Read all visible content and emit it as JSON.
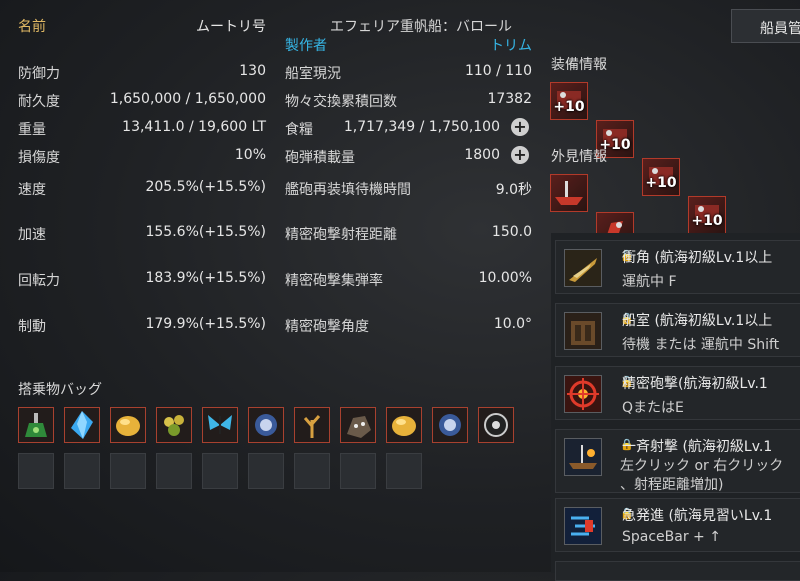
{
  "ship": {
    "name_label": "名前",
    "name_value": "ムートリ号",
    "type_value": "エフェリア重帆船：バロール",
    "maker_label": "製作者",
    "maker_value": "トリム"
  },
  "stats_left": [
    {
      "label": "防御力",
      "value": "130"
    },
    {
      "label": "耐久度",
      "value": "1,650,000 / 1,650,000"
    },
    {
      "label": "重量",
      "value": "13,411.0 / 19,600 LT"
    },
    {
      "label": "損傷度",
      "value": "10%"
    },
    {
      "label": "速度",
      "value": "205.5%(+15.5%)"
    },
    {
      "label": "加速",
      "value": "155.6%(+15.5%)"
    },
    {
      "label": "回転力",
      "value": "183.9%(+15.5%)"
    },
    {
      "label": "制動",
      "value": "179.9%(+15.5%)"
    }
  ],
  "stats_right": [
    {
      "label": "船室現況",
      "value": "110 / 110"
    },
    {
      "label": "物々交換累積回数",
      "value": "17382"
    },
    {
      "label": "食糧",
      "value": "1,717,349 / 1,750,100"
    },
    {
      "label": "砲弾積載量",
      "value": "1800"
    },
    {
      "label": "艦砲再装填待機時間",
      "value": "9.0秒"
    },
    {
      "label": "精密砲撃射程距離",
      "value": "150.0"
    },
    {
      "label": "精密砲撃集弾率",
      "value": "10.00%"
    },
    {
      "label": "精密砲撃角度",
      "value": "10.0°"
    }
  ],
  "plus_symbol": "+",
  "cargo": {
    "title": "搭乗物バッグ"
  },
  "crew_button": "船員管",
  "equipment": {
    "title": "装備情報",
    "enhance": [
      "+10",
      "+10",
      "+10",
      "+10"
    ]
  },
  "appearance": {
    "title": "外見情報"
  },
  "skills": [
    {
      "name": "衝角 (航海初級Lv.1以上",
      "key": "運航中 F"
    },
    {
      "name": "船室 (航海初級Lv.1以上",
      "key": "待機 または 運航中 Shift"
    },
    {
      "name": "精密砲撃(航海初級Lv.1",
      "key": "QまたはE"
    },
    {
      "name": "一斉射撃 (航海初級Lv.1",
      "key": "左クリック or 右クリック",
      "key2": "、射程距離増加)"
    },
    {
      "name": "急発進 (航海見習いLv.1",
      "key": "SpaceBar + ↑"
    }
  ],
  "colors": {
    "accent_gold": "#e0b864",
    "maker_cyan": "#36b6e6",
    "slot_border": "#a8412f"
  }
}
